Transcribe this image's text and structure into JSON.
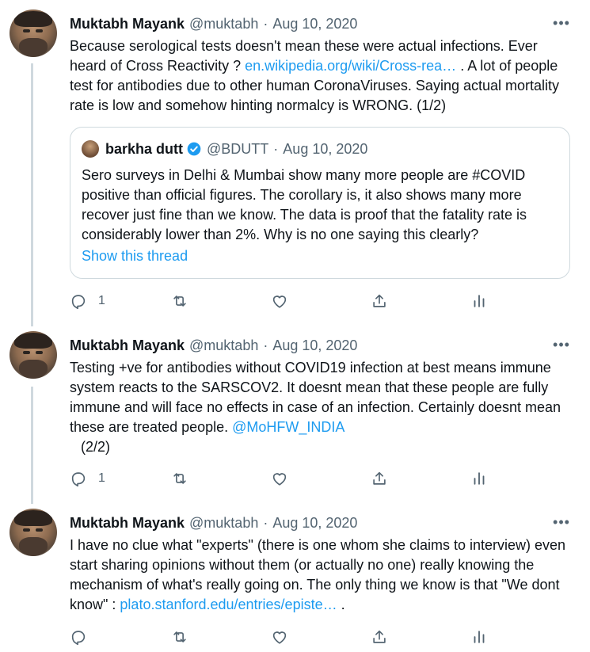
{
  "tweets": [
    {
      "name": "Muktabh Mayank",
      "handle": "@muktabh",
      "dot": "·",
      "date": "Aug 10, 2020",
      "text_1": "Because serological tests doesn't mean these were actual infections. Ever heard of Cross Reactivity ? ",
      "link": "en.wikipedia.org/wiki/Cross-rea…",
      "text_2": " . A lot of people test for antibodies due to other human CoronaViruses. Saying actual mortality rate is low and somehow hinting normalcy is WRONG. (1/2)",
      "reply_count": "1",
      "quote": {
        "name": "barkha dutt",
        "handle": "@BDUTT",
        "dot": "·",
        "date": "Aug 10, 2020",
        "text": "Sero surveys in Delhi & Mumbai show many more people are #COVID positive than official figures. The corollary is, it also shows many more recover just fine than we know. The data is proof that the fatality rate is considerably lower than 2%. Why is no one saying this clearly?",
        "show_thread": "Show this thread"
      }
    },
    {
      "name": "Muktabh Mayank",
      "handle": "@muktabh",
      "dot": "·",
      "date": "Aug 10, 2020",
      "text_1": "Testing +ve for antibodies without COVID19 infection at best means immune system reacts to the SARSCOV2. It doesnt mean that these people are fully immune and will face no effects in case of an infection. Certainly doesnt mean these are treated people. ",
      "link": "@MoHFW_INDIA",
      "text_2": "(2/2)",
      "reply_count": "1"
    },
    {
      "name": "Muktabh Mayank",
      "handle": "@muktabh",
      "dot": "·",
      "date": "Aug 10, 2020",
      "text_1": "I have no clue what \"experts\" (there is one whom she claims to interview) even start sharing opinions without them (or actually no one) really knowing the mechanism of what's really going on. The only thing we know is that \"We dont know\" : ",
      "link": "plato.stanford.edu/entries/episte…",
      "text_2": " .",
      "reply_count": ""
    }
  ],
  "more_glyph": "•••",
  "colors": {
    "link": "#1d9bf0",
    "muted": "#536471",
    "border": "#cfd9de",
    "text": "#0f1419"
  }
}
